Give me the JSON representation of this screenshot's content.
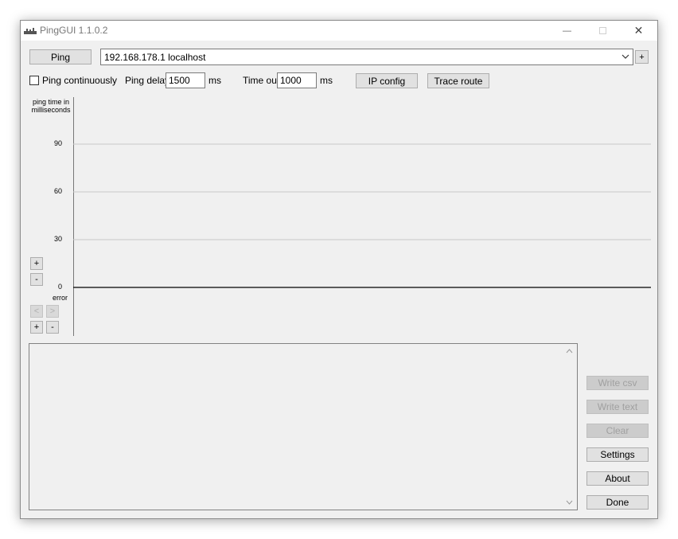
{
  "window": {
    "title": "PingGUI 1.1.0.2",
    "minimize_glyph": "—",
    "close_glyph": "✕"
  },
  "toolbar": {
    "ping_label": "Ping",
    "host_value": "192.168.178.1 localhost",
    "add_label": "+",
    "ping_continuously_label": "Ping continuously",
    "ping_continuously_checked": false,
    "ping_delay_label": "Ping delay",
    "ping_delay_value": "1500",
    "ping_delay_unit": "ms",
    "timeout_label": "Time out",
    "timeout_value": "1000",
    "timeout_unit": "ms",
    "ip_config_label": "IP config",
    "trace_route_label": "Trace route"
  },
  "chart_side": {
    "zoom_in_label": "+",
    "zoom_out_label": "-",
    "scroll_left_label": "<",
    "scroll_right_label": ">",
    "hzoom_in_label": "+",
    "hzoom_out_label": "-"
  },
  "chart_data": {
    "type": "line",
    "ylabel": "ping time in milliseconds",
    "ylim": [
      0,
      120
    ],
    "yticks": [
      90,
      60,
      30,
      0
    ],
    "error_label": "error",
    "series": [],
    "grid": true,
    "colors": {
      "grid": "#c8c8c8",
      "axis": "#000000"
    }
  },
  "side_buttons": {
    "write_csv": "Write csv",
    "write_text": "Write text",
    "clear": "Clear",
    "settings": "Settings",
    "about": "About",
    "done": "Done"
  },
  "log": {
    "text": ""
  },
  "colors": {
    "window_bg": "#f0f0f0",
    "button_bg": "#e1e1e1",
    "button_border": "#adadad",
    "disabled_text": "#a0a0a0"
  }
}
